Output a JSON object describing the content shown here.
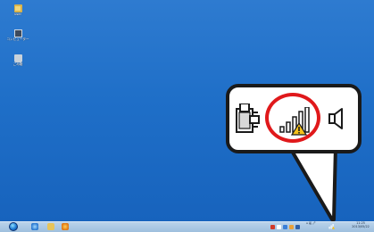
{
  "desktop": {
    "icons": [
      {
        "name": "folder-icon",
        "label": "user"
      },
      {
        "name": "computer-icon",
        "label": "コンピューター"
      },
      {
        "name": "recycle-bin-icon",
        "label": "ごみ箱"
      }
    ]
  },
  "callout": {
    "icons": [
      "power-plug-icon",
      "wifi-signal-warning-icon",
      "speaker-icon"
    ],
    "highlight_color": "#e0191b"
  },
  "taskbar": {
    "pinned": [
      "start-button",
      "internet-explorer-icon",
      "windows-explorer-icon",
      "media-player-icon"
    ],
    "language": "A 般 🖊",
    "clock": {
      "time": "11:25",
      "date": "2013/05/22"
    }
  },
  "colors": {
    "desktop_background": "#1f6fc8",
    "taskbar": "#b9d2ea",
    "callout_border": "#1a1a1a"
  }
}
